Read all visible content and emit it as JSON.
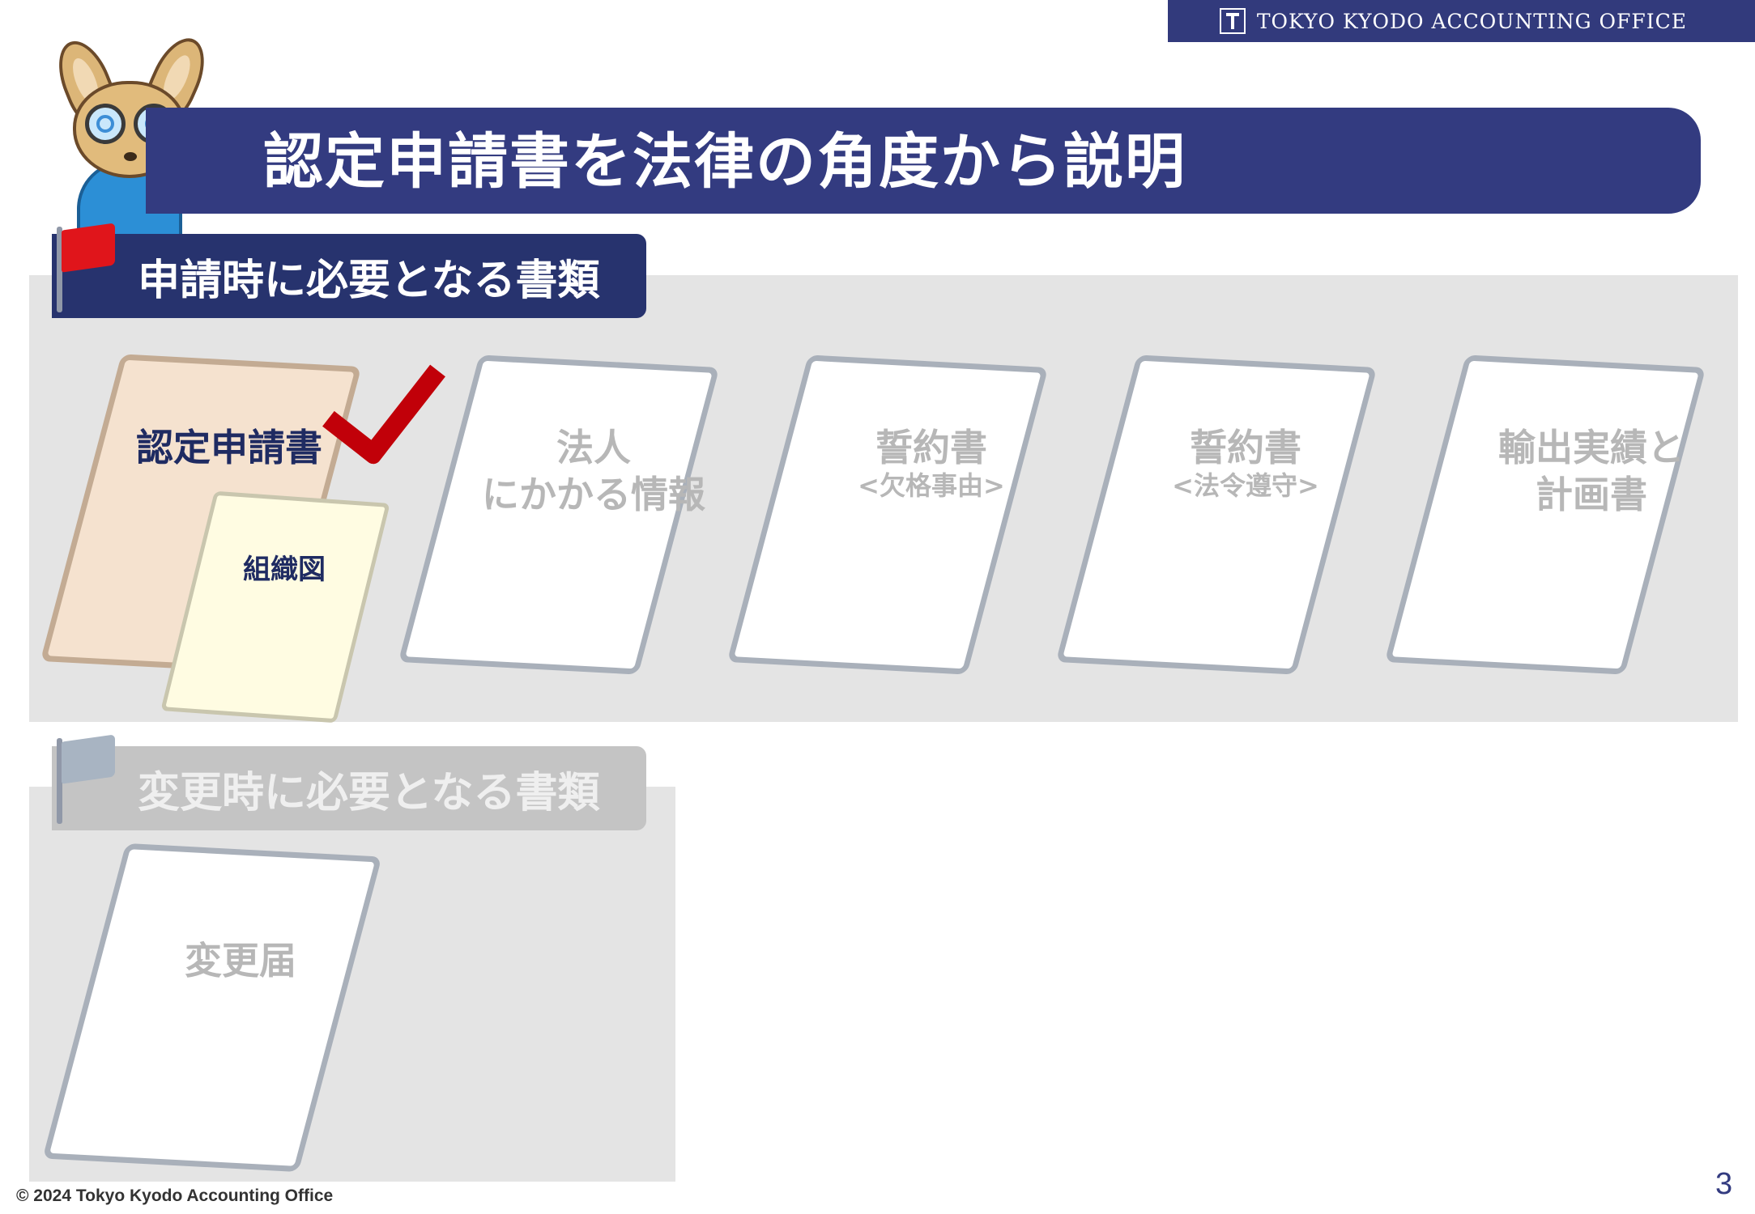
{
  "brand": {
    "name": "TOKYO KYODO ACCOUNTING OFFICE",
    "logo_icon": "tk-logo-icon"
  },
  "title": "認定申請書を法律の角度から説明",
  "section_application": {
    "heading": "申請時に必要となる書類",
    "flag_color": "#e0151b",
    "documents": [
      {
        "label": "認定申請書",
        "attached": "組織図",
        "checked": true
      },
      {
        "label_line1": "法人",
        "label_line2": "にかかる情報"
      },
      {
        "label": "誓約書",
        "sublabel": "<欠格事由>"
      },
      {
        "label": "誓約書",
        "sublabel": "<法令遵守>"
      },
      {
        "label_line1": "輸出実績と",
        "label_line2": "計画書"
      }
    ]
  },
  "section_change": {
    "heading": "変更時に必要となる書類",
    "flag_color": "#a8b4c2",
    "documents": [
      {
        "label": "変更届"
      }
    ]
  },
  "footer": {
    "copyright": "© 2024 Tokyo Kyodo Accounting Office",
    "page": "3"
  },
  "colors": {
    "navy": "#333b80",
    "panel": "#e4e4e4",
    "check": "#c10009"
  }
}
